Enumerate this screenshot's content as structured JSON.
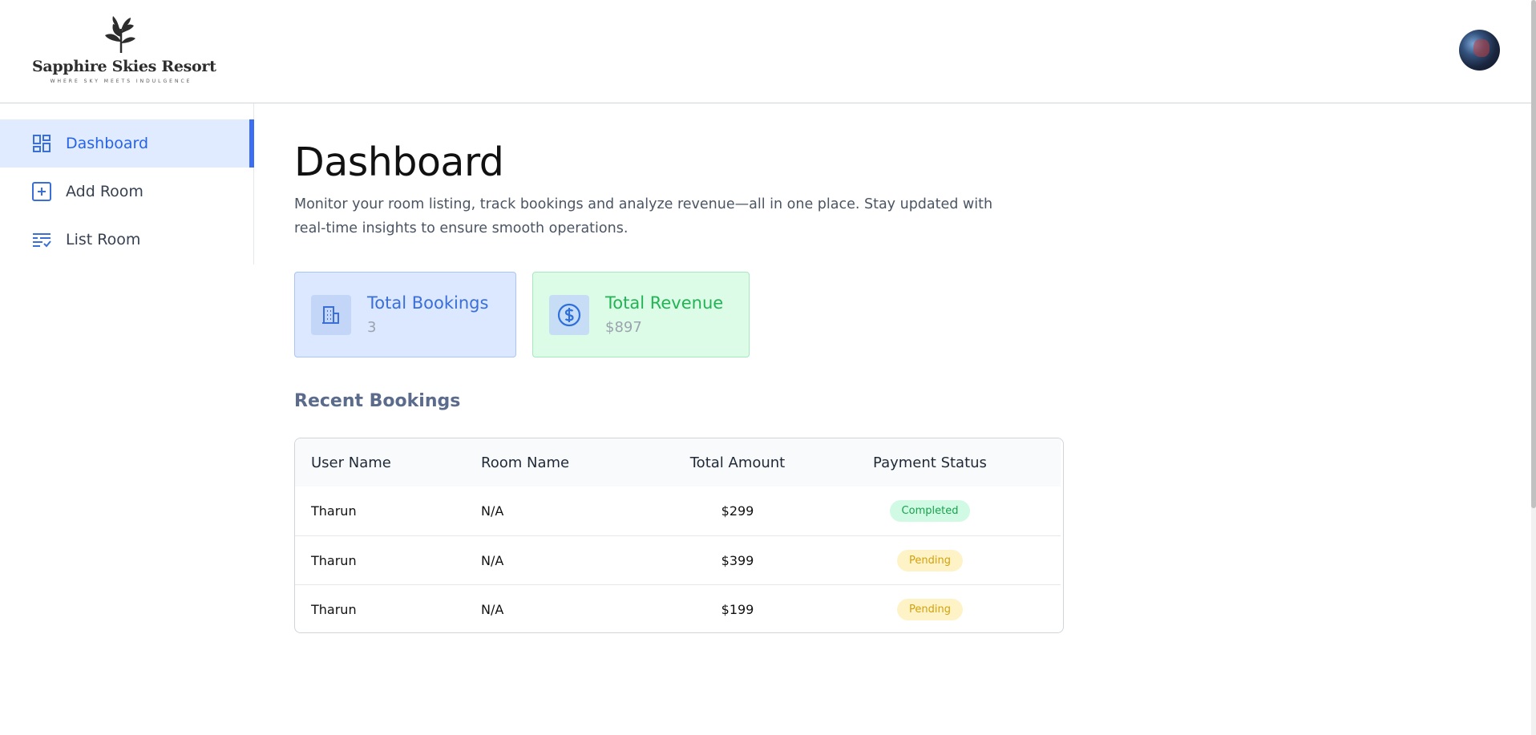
{
  "brand": {
    "name": "Sapphire Skies Resort",
    "tagline": "WHERE SKY MEETS INDULGENCE"
  },
  "user": {
    "avatar_icon": "user-avatar"
  },
  "sidebar": {
    "items": [
      {
        "label": "Dashboard",
        "icon": "dashboard-icon",
        "active": true
      },
      {
        "label": "Add Room",
        "icon": "add-square-icon",
        "active": false
      },
      {
        "label": "List Room",
        "icon": "list-check-icon",
        "active": false
      }
    ]
  },
  "main": {
    "title": "Dashboard",
    "description": "Monitor your room listing, track bookings and analyze revenue—all in one place. Stay updated with real-time insights to ensure smooth operations."
  },
  "stats": {
    "bookings": {
      "label": "Total Bookings",
      "value": "3",
      "icon": "building-icon",
      "accent": "#3b6fd8"
    },
    "revenue": {
      "label": "Total Revenue",
      "value": "$897",
      "icon": "dollar-circle-icon",
      "accent": "#22b454"
    }
  },
  "recent_bookings": {
    "title": "Recent Bookings",
    "columns": [
      "User Name",
      "Room Name",
      "Total Amount",
      "Payment Status"
    ],
    "rows": [
      {
        "user": "Tharun",
        "room": "N/A",
        "amount": "$299",
        "status": "Completed"
      },
      {
        "user": "Tharun",
        "room": "N/A",
        "amount": "$399",
        "status": "Pending"
      },
      {
        "user": "Tharun",
        "room": "N/A",
        "amount": "$199",
        "status": "Pending"
      }
    ]
  },
  "colors": {
    "primary": "#2563eb",
    "completed": "#16a34a",
    "pending": "#d4a10c"
  }
}
